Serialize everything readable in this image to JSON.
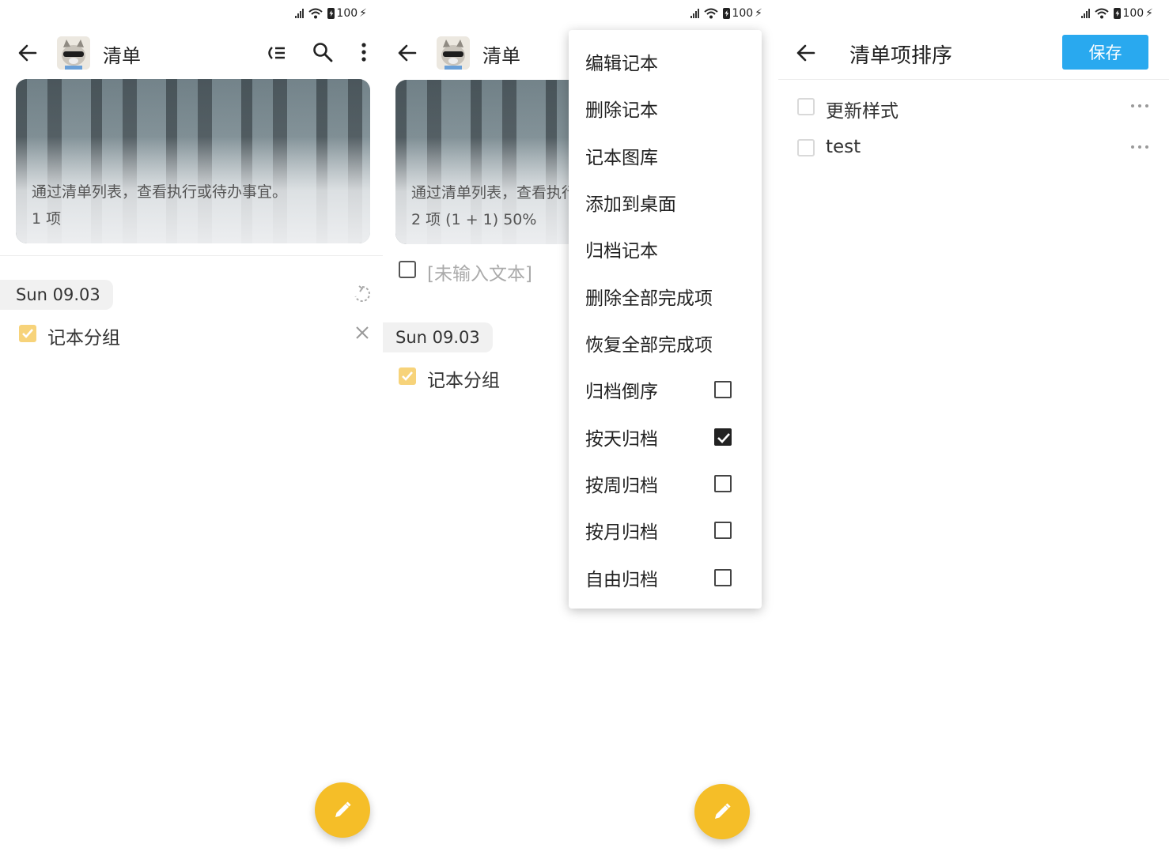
{
  "status_bar": {
    "battery": "100"
  },
  "panel_list": {
    "title": "清单",
    "banner_description": "通过清单列表，查看执行或待办事宜。",
    "banner_count": "1 项",
    "date_chip": "Sun 09.03",
    "group_item": "记本分组"
  },
  "panel_menu": {
    "title": "清单",
    "banner_description": "通过清单列表，查看执行或待办事宜。",
    "banner_count": "2 项 (1 + 1) 50%",
    "empty_item": "[未输入文本]",
    "date_chip": "Sun 09.03",
    "group_item": "记本分组",
    "menu": {
      "items": [
        {
          "label": "编辑记本"
        },
        {
          "label": "删除记本"
        },
        {
          "label": "记本图库"
        },
        {
          "label": "添加到桌面"
        },
        {
          "label": "归档记本"
        },
        {
          "label": "删除全部完成项"
        },
        {
          "label": "恢复全部完成项"
        },
        {
          "label": "归档倒序",
          "checked": false
        },
        {
          "label": "按天归档",
          "checked": true
        },
        {
          "label": "按周归档",
          "checked": false
        },
        {
          "label": "按月归档",
          "checked": false
        },
        {
          "label": "自由归档",
          "checked": false
        }
      ]
    }
  },
  "panel_sort": {
    "title": "清单项排序",
    "save_label": "保存",
    "items": [
      {
        "label": "更新样式"
      },
      {
        "label": "test"
      }
    ]
  },
  "colors": {
    "accent_fab": "#f5be28",
    "save_button": "#29a9ef",
    "check_yellow": "#f7d37a"
  }
}
